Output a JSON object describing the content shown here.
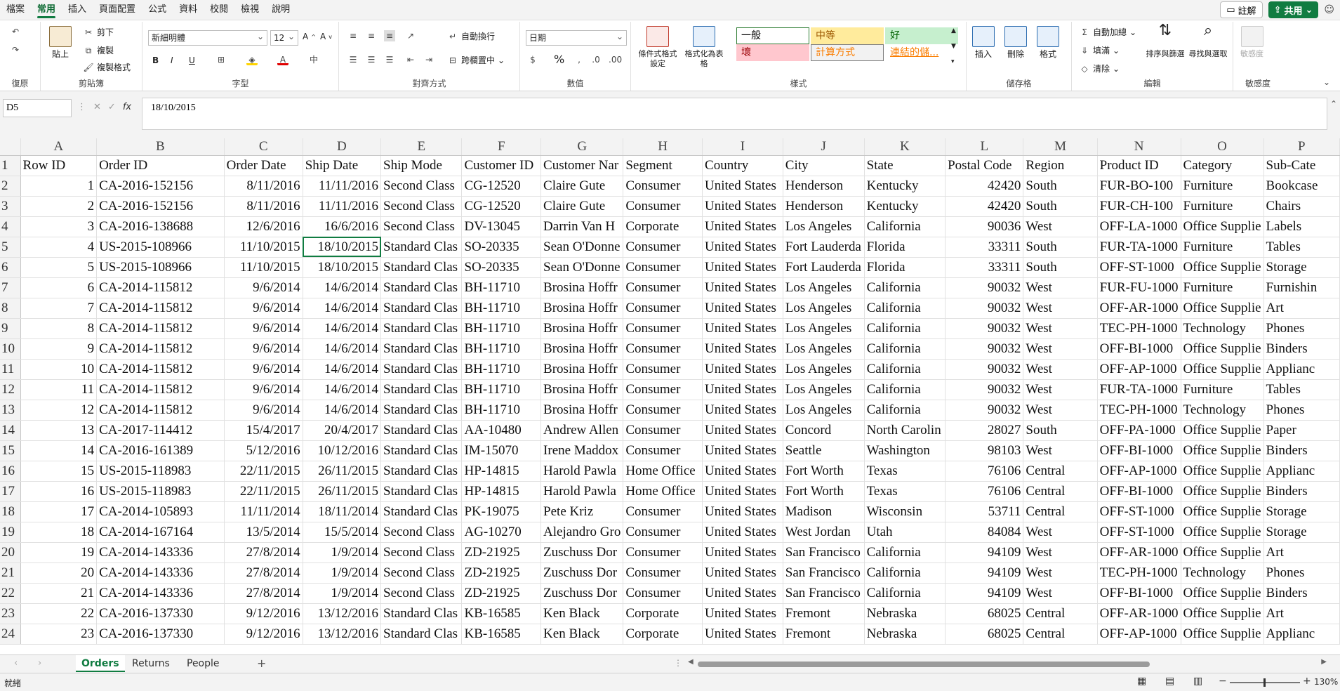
{
  "menu": {
    "items": [
      "檔案",
      "常用",
      "插入",
      "頁面配置",
      "公式",
      "資料",
      "校閱",
      "檢視",
      "說明"
    ],
    "active_index": 1,
    "comment_label": "註解",
    "share_label": "共用"
  },
  "ribbon": {
    "undo_group": "復原",
    "clipboard": {
      "label": "剪貼簿",
      "paste": "貼上",
      "cut": "剪下",
      "copy": "複製",
      "format_painter": "複製格式"
    },
    "font": {
      "label": "字型",
      "name": "新細明體",
      "size": "12",
      "bold": "B",
      "italic": "I",
      "underline": "U"
    },
    "alignment": {
      "label": "對齊方式",
      "wrap": "自動換行",
      "merge": "跨欄置中"
    },
    "number": {
      "label": "數值",
      "format": "日期",
      "percent": "%"
    },
    "styles": {
      "label": "樣式",
      "conditional": "條件式格式設定",
      "table": "格式化為表格",
      "cells": [
        {
          "text": "一般",
          "bg": "#ffffff",
          "color": "#000000",
          "border": "#2e7d32"
        },
        {
          "text": "中等",
          "bg": "#ffeb9c",
          "color": "#9c5700",
          "border": "#ffeb9c"
        },
        {
          "text": "好",
          "bg": "#c6efce",
          "color": "#006100",
          "border": "#c6efce"
        },
        {
          "text": "壞",
          "bg": "#ffc7ce",
          "color": "#9c0006",
          "border": "#ffc7ce"
        },
        {
          "text": "計算方式",
          "bg": "#f2f2f2",
          "color": "#fa7d00",
          "border": "#7f7f7f"
        },
        {
          "text": "連結的儲...",
          "bg": "#ffffff",
          "color": "#fa7d00",
          "border": "#ffffff"
        }
      ]
    },
    "cells_group": {
      "label": "儲存格",
      "insert": "插入",
      "delete": "刪除",
      "format": "格式"
    },
    "editing": {
      "label": "編輯",
      "autosum": "自動加總",
      "fill": "填滿",
      "clear": "清除",
      "sort": "排序與篩選",
      "find": "尋找與選取"
    },
    "sensitivity": {
      "label": "敏感度",
      "button": "敏感度"
    }
  },
  "formula_bar": {
    "name_box": "D5",
    "value": "18/10/2015"
  },
  "columns": [
    "A",
    "B",
    "C",
    "D",
    "E",
    "F",
    "G",
    "H",
    "I",
    "J",
    "K",
    "L",
    "M",
    "N",
    "O",
    "P"
  ],
  "headers": [
    "Row ID",
    "Order ID",
    "Order Date",
    "Ship Date",
    "Ship Mode",
    "Customer ID",
    "Customer Nar",
    "Segment",
    "Country",
    "City",
    "State",
    "Postal Code",
    "Region",
    "Product ID",
    "Category",
    "Sub-Cate"
  ],
  "rows": [
    [
      "1",
      "CA-2016-152156",
      "8/11/2016",
      "11/11/2016",
      "Second Class",
      "CG-12520",
      "Claire Gute",
      "Consumer",
      "United States",
      "Henderson",
      "Kentucky",
      "42420",
      "South",
      "FUR-BO-100",
      "Furniture",
      "Bookcase"
    ],
    [
      "2",
      "CA-2016-152156",
      "8/11/2016",
      "11/11/2016",
      "Second Class",
      "CG-12520",
      "Claire Gute",
      "Consumer",
      "United States",
      "Henderson",
      "Kentucky",
      "42420",
      "South",
      "FUR-CH-100",
      "Furniture",
      "Chairs"
    ],
    [
      "3",
      "CA-2016-138688",
      "12/6/2016",
      "16/6/2016",
      "Second Class",
      "DV-13045",
      "Darrin Van H",
      "Corporate",
      "United States",
      "Los Angeles",
      "California",
      "90036",
      "West",
      "OFF-LA-1000",
      "Office Supplie",
      "Labels"
    ],
    [
      "4",
      "US-2015-108966",
      "11/10/2015",
      "18/10/2015",
      "Standard Clas",
      "SO-20335",
      "Sean O'Donne",
      "Consumer",
      "United States",
      "Fort Lauderda",
      "Florida",
      "33311",
      "South",
      "FUR-TA-1000",
      "Furniture",
      "Tables"
    ],
    [
      "5",
      "US-2015-108966",
      "11/10/2015",
      "18/10/2015",
      "Standard Clas",
      "SO-20335",
      "Sean O'Donne",
      "Consumer",
      "United States",
      "Fort Lauderda",
      "Florida",
      "33311",
      "South",
      "OFF-ST-1000",
      "Office Supplie",
      "Storage"
    ],
    [
      "6",
      "CA-2014-115812",
      "9/6/2014",
      "14/6/2014",
      "Standard Clas",
      "BH-11710",
      "Brosina Hoffr",
      "Consumer",
      "United States",
      "Los Angeles",
      "California",
      "90032",
      "West",
      "FUR-FU-1000",
      "Furniture",
      "Furnishin"
    ],
    [
      "7",
      "CA-2014-115812",
      "9/6/2014",
      "14/6/2014",
      "Standard Clas",
      "BH-11710",
      "Brosina Hoffr",
      "Consumer",
      "United States",
      "Los Angeles",
      "California",
      "90032",
      "West",
      "OFF-AR-1000",
      "Office Supplie",
      "Art"
    ],
    [
      "8",
      "CA-2014-115812",
      "9/6/2014",
      "14/6/2014",
      "Standard Clas",
      "BH-11710",
      "Brosina Hoffr",
      "Consumer",
      "United States",
      "Los Angeles",
      "California",
      "90032",
      "West",
      "TEC-PH-1000",
      "Technology",
      "Phones"
    ],
    [
      "9",
      "CA-2014-115812",
      "9/6/2014",
      "14/6/2014",
      "Standard Clas",
      "BH-11710",
      "Brosina Hoffr",
      "Consumer",
      "United States",
      "Los Angeles",
      "California",
      "90032",
      "West",
      "OFF-BI-1000",
      "Office Supplie",
      "Binders"
    ],
    [
      "10",
      "CA-2014-115812",
      "9/6/2014",
      "14/6/2014",
      "Standard Clas",
      "BH-11710",
      "Brosina Hoffr",
      "Consumer",
      "United States",
      "Los Angeles",
      "California",
      "90032",
      "West",
      "OFF-AP-1000",
      "Office Supplie",
      "Applianc"
    ],
    [
      "11",
      "CA-2014-115812",
      "9/6/2014",
      "14/6/2014",
      "Standard Clas",
      "BH-11710",
      "Brosina Hoffr",
      "Consumer",
      "United States",
      "Los Angeles",
      "California",
      "90032",
      "West",
      "FUR-TA-1000",
      "Furniture",
      "Tables"
    ],
    [
      "12",
      "CA-2014-115812",
      "9/6/2014",
      "14/6/2014",
      "Standard Clas",
      "BH-11710",
      "Brosina Hoffr",
      "Consumer",
      "United States",
      "Los Angeles",
      "California",
      "90032",
      "West",
      "TEC-PH-1000",
      "Technology",
      "Phones"
    ],
    [
      "13",
      "CA-2017-114412",
      "15/4/2017",
      "20/4/2017",
      "Standard Clas",
      "AA-10480",
      "Andrew Allen",
      "Consumer",
      "United States",
      "Concord",
      "North Carolin",
      "28027",
      "South",
      "OFF-PA-1000",
      "Office Supplie",
      "Paper"
    ],
    [
      "14",
      "CA-2016-161389",
      "5/12/2016",
      "10/12/2016",
      "Standard Clas",
      "IM-15070",
      "Irene Maddox",
      "Consumer",
      "United States",
      "Seattle",
      "Washington",
      "98103",
      "West",
      "OFF-BI-1000",
      "Office Supplie",
      "Binders"
    ],
    [
      "15",
      "US-2015-118983",
      "22/11/2015",
      "26/11/2015",
      "Standard Clas",
      "HP-14815",
      "Harold Pawla",
      "Home Office",
      "United States",
      "Fort Worth",
      "Texas",
      "76106",
      "Central",
      "OFF-AP-1000",
      "Office Supplie",
      "Applianc"
    ],
    [
      "16",
      "US-2015-118983",
      "22/11/2015",
      "26/11/2015",
      "Standard Clas",
      "HP-14815",
      "Harold Pawla",
      "Home Office",
      "United States",
      "Fort Worth",
      "Texas",
      "76106",
      "Central",
      "OFF-BI-1000",
      "Office Supplie",
      "Binders"
    ],
    [
      "17",
      "CA-2014-105893",
      "11/11/2014",
      "18/11/2014",
      "Standard Clas",
      "PK-19075",
      "Pete Kriz",
      "Consumer",
      "United States",
      "Madison",
      "Wisconsin",
      "53711",
      "Central",
      "OFF-ST-1000",
      "Office Supplie",
      "Storage"
    ],
    [
      "18",
      "CA-2014-167164",
      "13/5/2014",
      "15/5/2014",
      "Second Class",
      "AG-10270",
      "Alejandro Gro",
      "Consumer",
      "United States",
      "West Jordan",
      "Utah",
      "84084",
      "West",
      "OFF-ST-1000",
      "Office Supplie",
      "Storage"
    ],
    [
      "19",
      "CA-2014-143336",
      "27/8/2014",
      "1/9/2014",
      "Second Class",
      "ZD-21925",
      "Zuschuss Dor",
      "Consumer",
      "United States",
      "San Francisco",
      "California",
      "94109",
      "West",
      "OFF-AR-1000",
      "Office Supplie",
      "Art"
    ],
    [
      "20",
      "CA-2014-143336",
      "27/8/2014",
      "1/9/2014",
      "Second Class",
      "ZD-21925",
      "Zuschuss Dor",
      "Consumer",
      "United States",
      "San Francisco",
      "California",
      "94109",
      "West",
      "TEC-PH-1000",
      "Technology",
      "Phones"
    ],
    [
      "21",
      "CA-2014-143336",
      "27/8/2014",
      "1/9/2014",
      "Second Class",
      "ZD-21925",
      "Zuschuss Dor",
      "Consumer",
      "United States",
      "San Francisco",
      "California",
      "94109",
      "West",
      "OFF-BI-1000",
      "Office Supplie",
      "Binders"
    ],
    [
      "22",
      "CA-2016-137330",
      "9/12/2016",
      "13/12/2016",
      "Standard Clas",
      "KB-16585",
      "Ken Black",
      "Corporate",
      "United States",
      "Fremont",
      "Nebraska",
      "68025",
      "Central",
      "OFF-AR-1000",
      "Office Supplie",
      "Art"
    ],
    [
      "23",
      "CA-2016-137330",
      "9/12/2016",
      "13/12/2016",
      "Standard Clas",
      "KB-16585",
      "Ken Black",
      "Corporate",
      "United States",
      "Fremont",
      "Nebraska",
      "68025",
      "Central",
      "OFF-AP-1000",
      "Office Supplie",
      "Applianc"
    ]
  ],
  "sheets": [
    "Orders",
    "Returns",
    "People"
  ],
  "active_sheet": 0,
  "status": {
    "ready": "就緒",
    "zoom": "130%"
  }
}
